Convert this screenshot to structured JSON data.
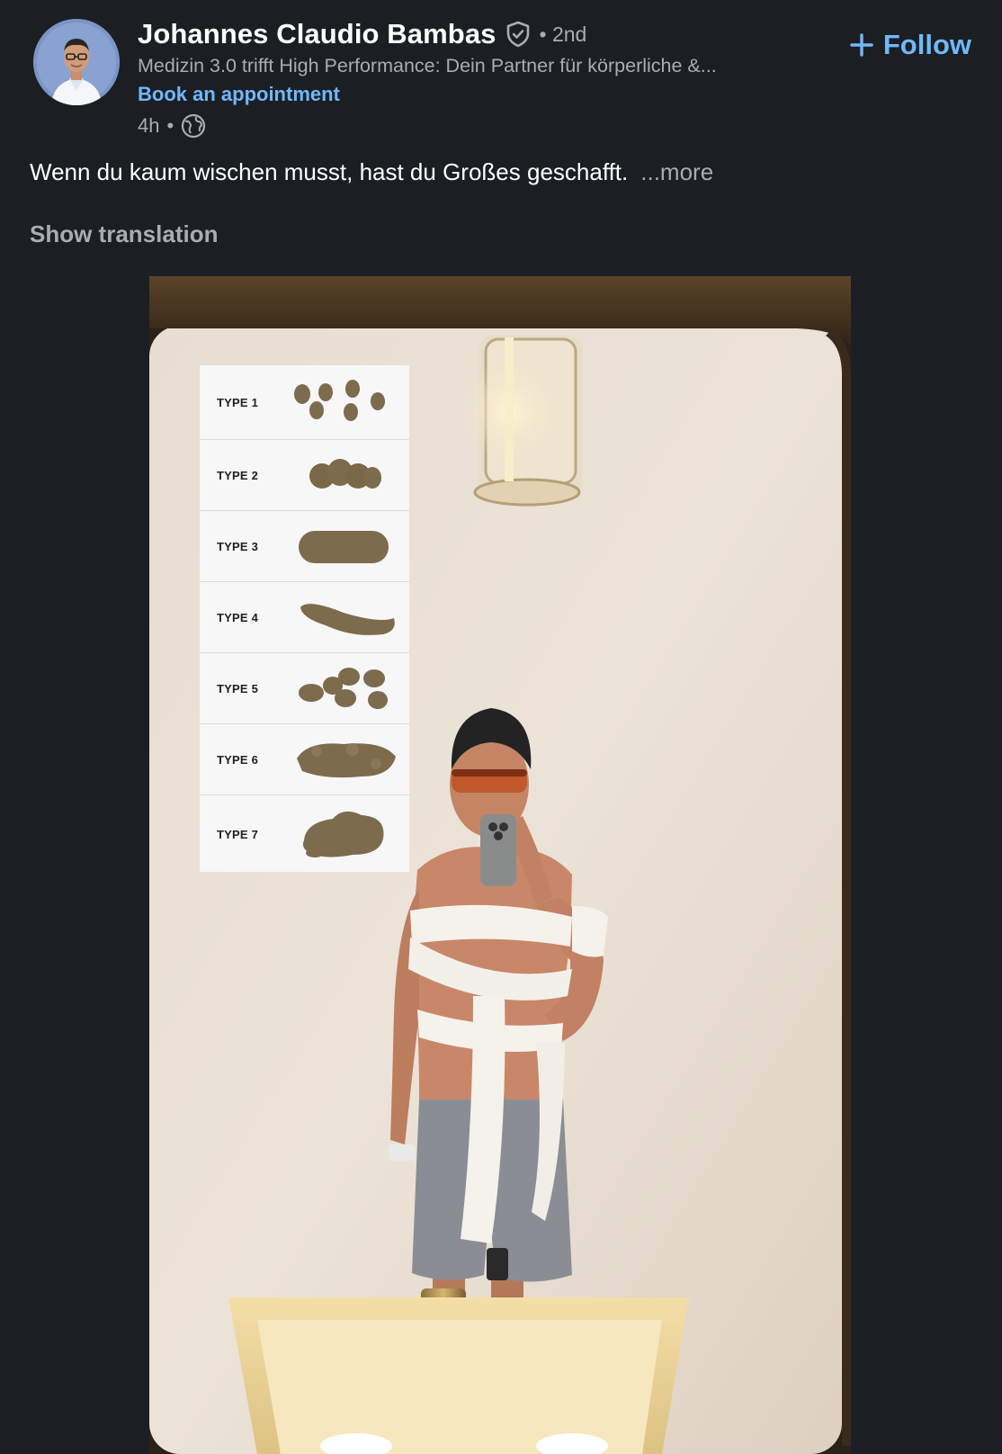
{
  "author": {
    "name": "Johannes Claudio Bambas",
    "degree": "• 2nd",
    "headline": "Medizin 3.0 trifft High Performance: Dein Partner für körperliche &...",
    "appointment_link": "Book an appointment",
    "time": "4h",
    "meta_separator": "•",
    "visibility_icon": "globe-icon",
    "verified_icon": "verified-shield-icon"
  },
  "follow": {
    "icon": "plus-icon",
    "label": "Follow"
  },
  "post": {
    "text": "Wenn du kaum wischen musst, hast du Großes geschafft.",
    "more": "...more",
    "show_translation": "Show translation"
  },
  "image_chart": {
    "rows": [
      {
        "label": "TYPE 1"
      },
      {
        "label": "TYPE 2"
      },
      {
        "label": "TYPE 3"
      },
      {
        "label": "TYPE 4"
      },
      {
        "label": "TYPE 5"
      },
      {
        "label": "TYPE 6"
      },
      {
        "label": "TYPE 7"
      }
    ]
  },
  "colors": {
    "background": "#1b1f23",
    "link": "#71b7fb",
    "muted_text": "#a9adb1",
    "primary_text": "#ffffff"
  }
}
